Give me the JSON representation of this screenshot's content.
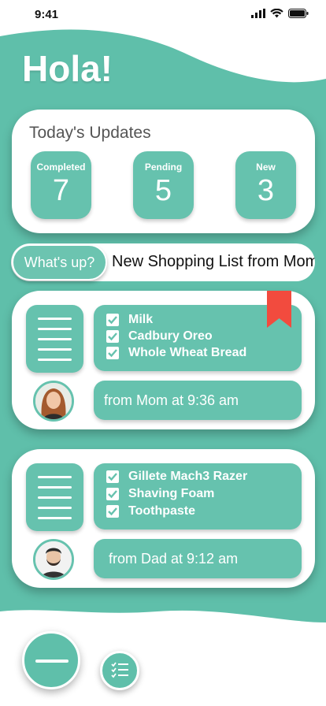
{
  "status_bar": {
    "time": "9:41"
  },
  "header": {
    "title": "Hola!"
  },
  "colors": {
    "accent": "#5fbfaa",
    "card_accent": "#66c2ae",
    "bookmark": "#f24b3e"
  },
  "updates": {
    "title": "Today's Updates",
    "stats": [
      {
        "label": "Completed",
        "value": "7"
      },
      {
        "label": "Pending",
        "value": "5"
      },
      {
        "label": "New",
        "value": "3"
      }
    ]
  },
  "ticker": {
    "button_label": "What's up?",
    "text": "New Shopping List from Mom"
  },
  "lists": [
    {
      "items": [
        "Milk",
        "Cadbury Oreo",
        "Whole Wheat Bread"
      ],
      "from": "from Mom at 9:36 am"
    },
    {
      "items": [
        "Gillete Mach3 Razer",
        "Shaving Foam",
        "Toothpaste"
      ],
      "from": "from Dad at 9:12 am"
    }
  ],
  "icons": {
    "qr": "qr-code-icon",
    "lines": "list-lines-icon",
    "check": "checkbox-checked-icon",
    "bookmark": "bookmark-icon",
    "fab": "minus-icon",
    "checklist": "checklist-icon"
  }
}
